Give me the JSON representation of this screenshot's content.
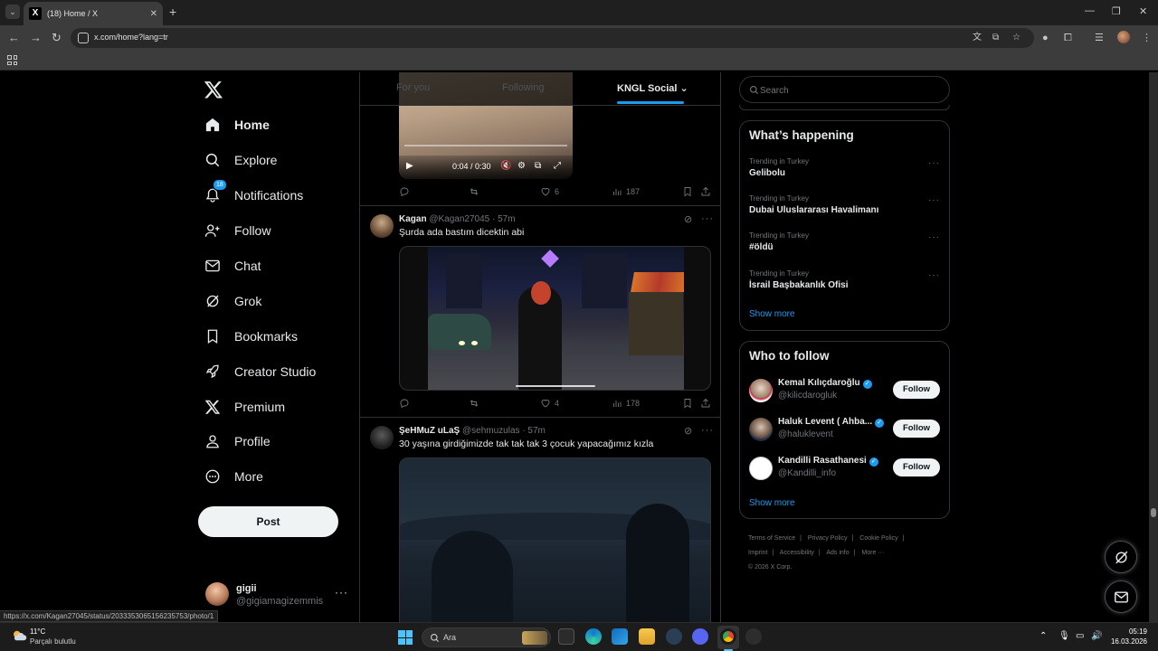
{
  "browser": {
    "tab_title": "(18) Home / X",
    "tab_favicon": "X",
    "tab_close": "✕",
    "new_tab": "+",
    "url": "x.com/home?lang=tr",
    "window_controls": [
      "—",
      "❐",
      "✕"
    ]
  },
  "nav": {
    "items": [
      {
        "label": "Home",
        "icon": "home-icon",
        "active": true
      },
      {
        "label": "Explore",
        "icon": "search-icon"
      },
      {
        "label": "Notifications",
        "icon": "bell-icon",
        "badge": "18"
      },
      {
        "label": "Follow",
        "icon": "person-plus-icon"
      },
      {
        "label": "Chat",
        "icon": "mail-icon"
      },
      {
        "label": "Grok",
        "icon": "grok-icon"
      },
      {
        "label": "Bookmarks",
        "icon": "bookmark-icon"
      },
      {
        "label": "Creator Studio",
        "icon": "rocket-icon"
      },
      {
        "label": "Premium",
        "icon": "x-icon"
      },
      {
        "label": "Profile",
        "icon": "person-icon"
      },
      {
        "label": "More",
        "icon": "more-circle-icon"
      }
    ],
    "post_label": "Post",
    "account": {
      "name": "gigii",
      "handle": "@gigiamagizemmis",
      "more": "···"
    }
  },
  "feed": {
    "tabs": [
      {
        "label": "For you"
      },
      {
        "label": "Following"
      },
      {
        "label": "KNGL Social",
        "active": true,
        "dropdown": true
      }
    ],
    "video1": {
      "time": "0:04 / 0:30"
    },
    "actions1": {
      "replies": "",
      "reposts": "",
      "likes": "6",
      "views": "187"
    },
    "tweet2": {
      "name": "Kagan",
      "handle": "@Kagan27045",
      "time": "· 57m",
      "text": "Şurda ada bastım dicektin abi",
      "actions": {
        "replies": "",
        "reposts": "",
        "likes": "4",
        "views": "178"
      }
    },
    "tweet3": {
      "name": "ŞeHMuZ uLaŞ",
      "handle": "@sehmuzulas",
      "time": "· 57m",
      "text": "30 yaşına girdiğimizde tak tak tak 3 çocuk yapacağımız kızla"
    }
  },
  "sidebar": {
    "search_placeholder": "Search",
    "trends_title": "What’s happening",
    "trends": [
      {
        "meta": "Trending in Turkey",
        "name": "Gelibolu"
      },
      {
        "meta": "Trending in Turkey",
        "name": "Dubai Uluslararası Havalimanı"
      },
      {
        "meta": "Trending in Turkey",
        "name": "#öldü"
      },
      {
        "meta": "Trending in Turkey",
        "name": "İsrail Başbakanlık Ofisi"
      }
    ],
    "trends_show_more": "Show more",
    "wtf_title": "Who to follow",
    "who_to_follow": [
      {
        "name": "Kemal Kılıçdaroğlu",
        "handle": "@kilicdarogluk",
        "verified": true,
        "button": "Follow"
      },
      {
        "name": "Haluk Levent ( Ahba...",
        "handle": "@haluklevent",
        "verified": true,
        "button": "Follow"
      },
      {
        "name": "Kandilli Rasathanesi",
        "handle": "@Kandilli_info",
        "verified": true,
        "button": "Follow"
      }
    ],
    "wtf_show_more": "Show more",
    "footer": {
      "links_row1": [
        "Terms of Service",
        "Privacy Policy",
        "Cookie Policy"
      ],
      "links_row2": [
        "Imprint",
        "Accessibility",
        "Ads info",
        "More ···"
      ],
      "copyright": "© 2026 X Corp."
    }
  },
  "status_url": "https://x.com/Kagan27045/status/2033353065156235753/photo/1",
  "taskbar": {
    "weather_temp": "11°C",
    "weather_desc": "Parçalı bulutlu",
    "search_label": "Ara",
    "time": "05:19",
    "date": "16.03.2026"
  },
  "colors": {
    "accent": "#1d9bf0",
    "background": "#000000",
    "text": "#e7e9ea",
    "muted": "#71767b",
    "border": "#2f3336"
  }
}
